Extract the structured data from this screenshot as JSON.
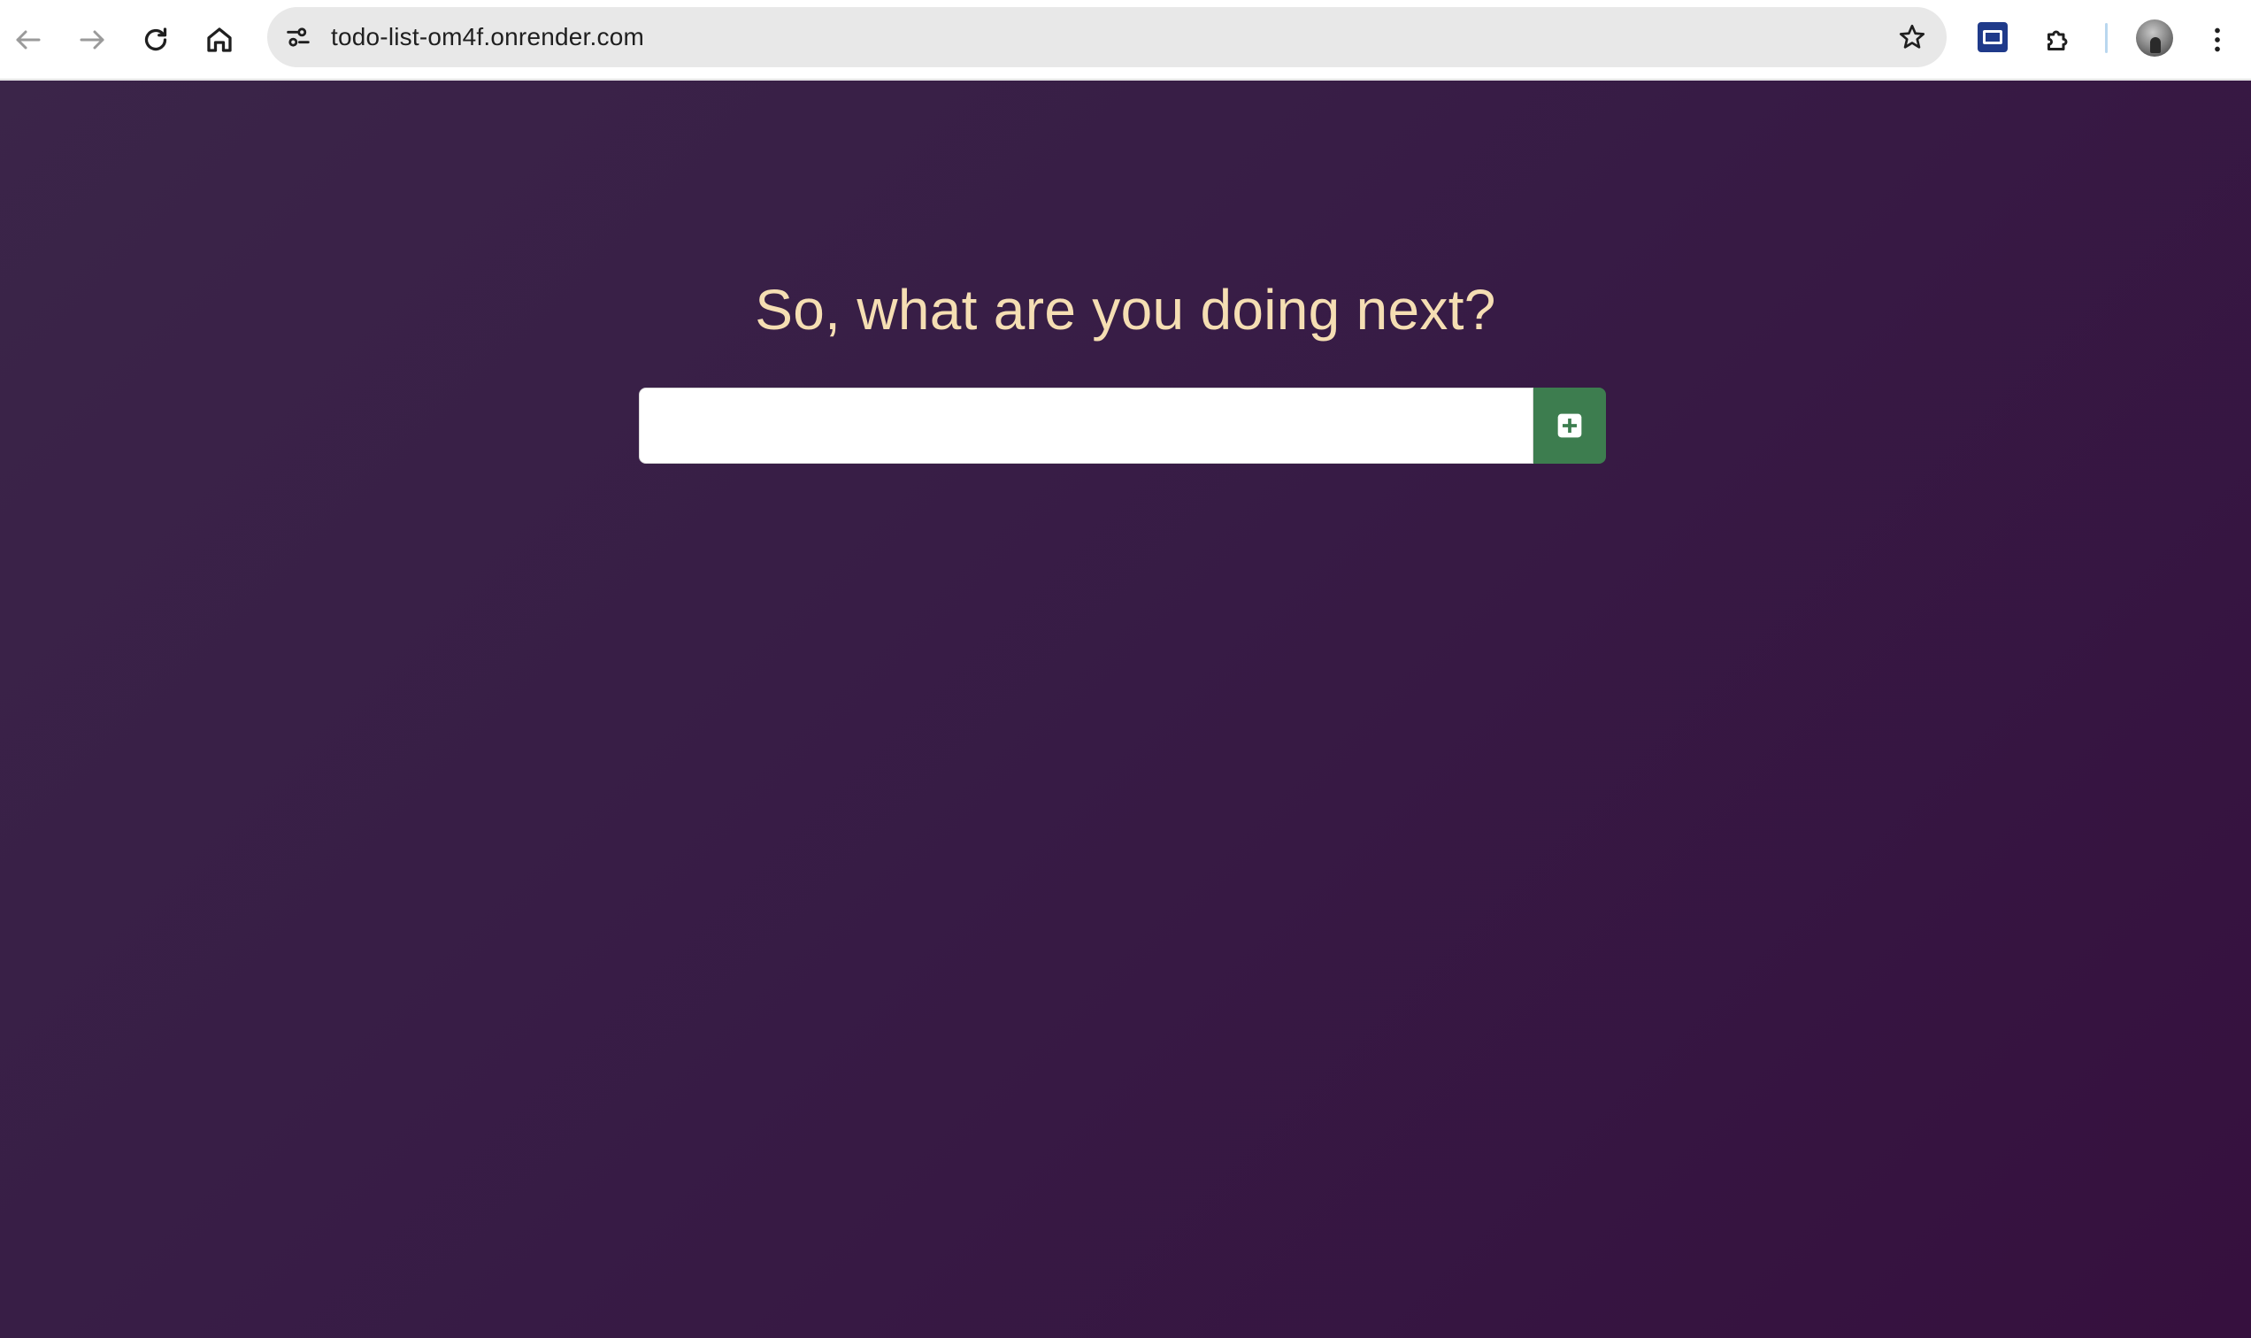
{
  "browser": {
    "url": "todo-list-om4f.onrender.com",
    "icons": {
      "back": "arrow-left-icon",
      "forward": "arrow-right-icon",
      "reload": "reload-icon",
      "home": "home-icon",
      "site_info": "tune-icon",
      "bookmark": "star-icon",
      "extension_app": "app-window-icon",
      "extensions": "puzzle-icon",
      "profile": "avatar",
      "menu": "kebab-menu-icon"
    }
  },
  "page": {
    "heading": "So, what are you doing next?",
    "input_value": "",
    "input_placeholder": "",
    "add_button_icon": "plus-square-icon",
    "colors": {
      "background_start": "#3b2549",
      "background_end": "#36103e",
      "heading": "#f5deb3",
      "add_button": "#3d7d4f"
    }
  }
}
